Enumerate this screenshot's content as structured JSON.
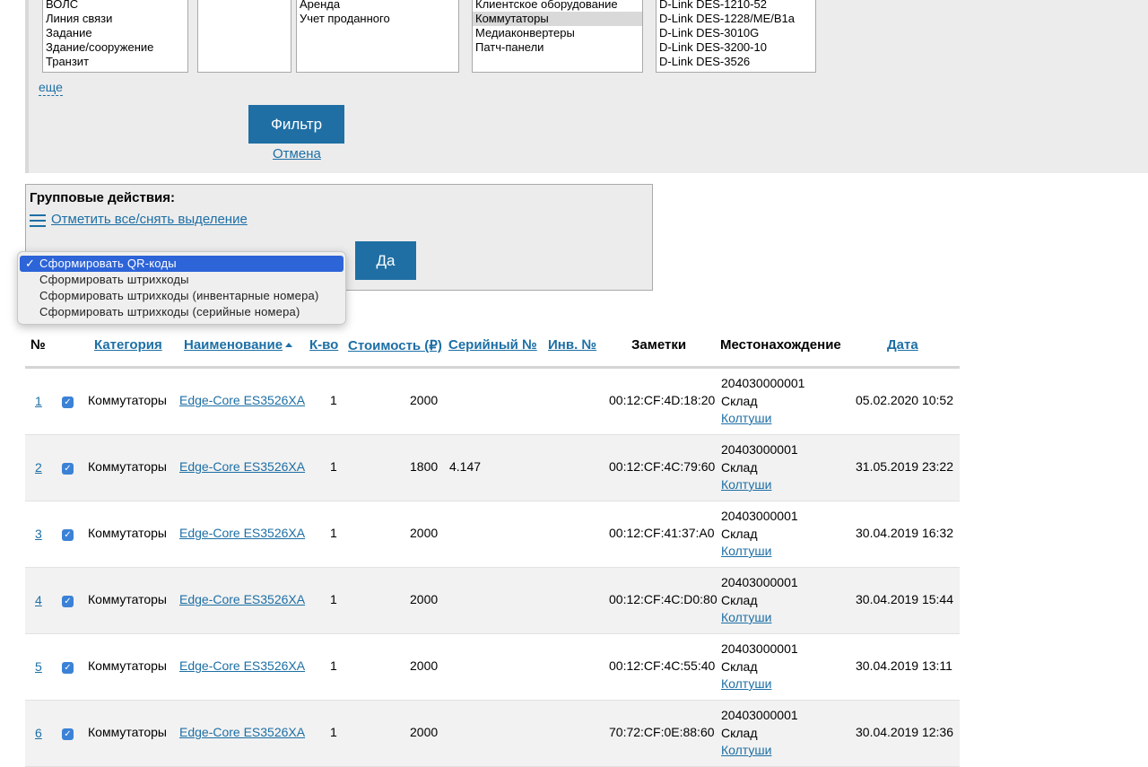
{
  "filter": {
    "list1": [
      "ВОЛС",
      "Линия связи",
      "Задание",
      "Здание/сооружение",
      "Транзит"
    ],
    "list2": [],
    "list3": [
      "Аренда",
      "Учет проданного"
    ],
    "list4": [
      "Клиентское оборудование",
      "Коммутаторы",
      "Медиаконвертеры",
      "Патч-панели"
    ],
    "list4_selected": "Коммутаторы",
    "list5": [
      "D-Link DES-1210-52",
      "D-Link DES-1228/ME/B1a",
      "D-Link DES-3010G",
      "D-Link DES-3200-10",
      "D-Link DES-3526"
    ],
    "more_link": "еще",
    "filter_button": "Фильтр",
    "cancel_link": "Отмена"
  },
  "group_actions": {
    "title": "Групповые действия:",
    "select_all_link": "Отметить все/снять выделение",
    "submit_button": "Да",
    "options": [
      "Сформировать QR-коды",
      "Сформировать штрихкоды",
      "Сформировать штрихкоды (инвентарные номера)",
      "Сформировать штрихкоды (серийные номера)"
    ],
    "selected_index": 0
  },
  "table": {
    "headers": {
      "num": "№",
      "category": "Категория",
      "name": "Наименование",
      "qty": "К-во",
      "cost": "Стоимость (₽)",
      "serial": "Серийный №",
      "inv": "Инв. №",
      "notes": "Заметки",
      "location": "Местонахождение",
      "date": "Дата"
    },
    "rows": [
      {
        "num": "1",
        "category": "Коммутаторы",
        "name": "Edge-Core ES3526XA",
        "qty": "1",
        "cost": "2000",
        "serial": "",
        "notes": "00:12:CF:4D:18:20",
        "loc_code": "204030000001",
        "loc_place": "Склад",
        "loc_person": "Колтуши",
        "date": "05.02.2020 10:52"
      },
      {
        "num": "2",
        "category": "Коммутаторы",
        "name": "Edge-Core ES3526XA",
        "qty": "1",
        "cost": "1800",
        "serial": "4.147",
        "notes": "00:12:CF:4C:79:60",
        "loc_code": "20403000001",
        "loc_place": "Склад",
        "loc_person": "Колтуши",
        "date": "31.05.2019 23:22"
      },
      {
        "num": "3",
        "category": "Коммутаторы",
        "name": "Edge-Core ES3526XA",
        "qty": "1",
        "cost": "2000",
        "serial": "",
        "notes": "00:12:CF:41:37:A0",
        "loc_code": "20403000001",
        "loc_place": "Склад",
        "loc_person": "Колтуши",
        "date": "30.04.2019 16:32"
      },
      {
        "num": "4",
        "category": "Коммутаторы",
        "name": "Edge-Core ES3526XA",
        "qty": "1",
        "cost": "2000",
        "serial": "",
        "notes": "00:12:CF:4C:D0:80",
        "loc_code": "20403000001",
        "loc_place": "Склад",
        "loc_person": "Колтуши",
        "date": "30.04.2019 15:44"
      },
      {
        "num": "5",
        "category": "Коммутаторы",
        "name": "Edge-Core ES3526XA",
        "qty": "1",
        "cost": "2000",
        "serial": "",
        "notes": "00:12:CF:4C:55:40",
        "loc_code": "20403000001",
        "loc_place": "Склад",
        "loc_person": "Колтуши",
        "date": "30.04.2019 13:11"
      },
      {
        "num": "6",
        "category": "Коммутаторы",
        "name": "Edge-Core ES3526XA",
        "qty": "1",
        "cost": "2000",
        "serial": "",
        "notes": "70:72:CF:0E:88:60",
        "loc_code": "20403000001",
        "loc_place": "Склад",
        "loc_person": "Колтуши",
        "date": "30.04.2019 12:36"
      }
    ]
  },
  "colors": {
    "accent": "#1f6fa4",
    "link": "#1d6fa5",
    "dropdown_selected": "#2d64d8",
    "checkbox": "#3b82d6"
  }
}
